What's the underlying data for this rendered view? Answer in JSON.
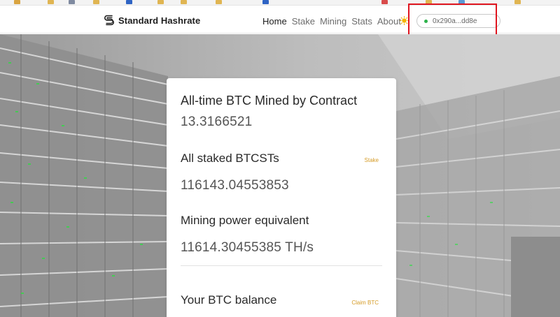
{
  "header": {
    "brand_name": "Standard Hashrate",
    "nav": [
      "Home",
      "Stake",
      "Mining",
      "Stats",
      "About"
    ],
    "active_nav": "Home",
    "wallet_address": "0x290a...dd8e",
    "wallet_status_color": "#2db24a",
    "theme_icon": "sun-icon"
  },
  "card": {
    "mined_title": "All-time BTC Mined by Contract",
    "mined_value": "13.3166521",
    "staked_title": "All staked BTCSTs",
    "staked_link": "Stake",
    "staked_value": "116143.04553853",
    "power_title": "Mining power equivalent",
    "power_value": "11614.30455385 TH/s",
    "balance_title": "Your BTC balance",
    "balance_link": "Claim BTC"
  },
  "colors": {
    "accent": "#d59b26",
    "highlight_box": "#e0151f"
  }
}
